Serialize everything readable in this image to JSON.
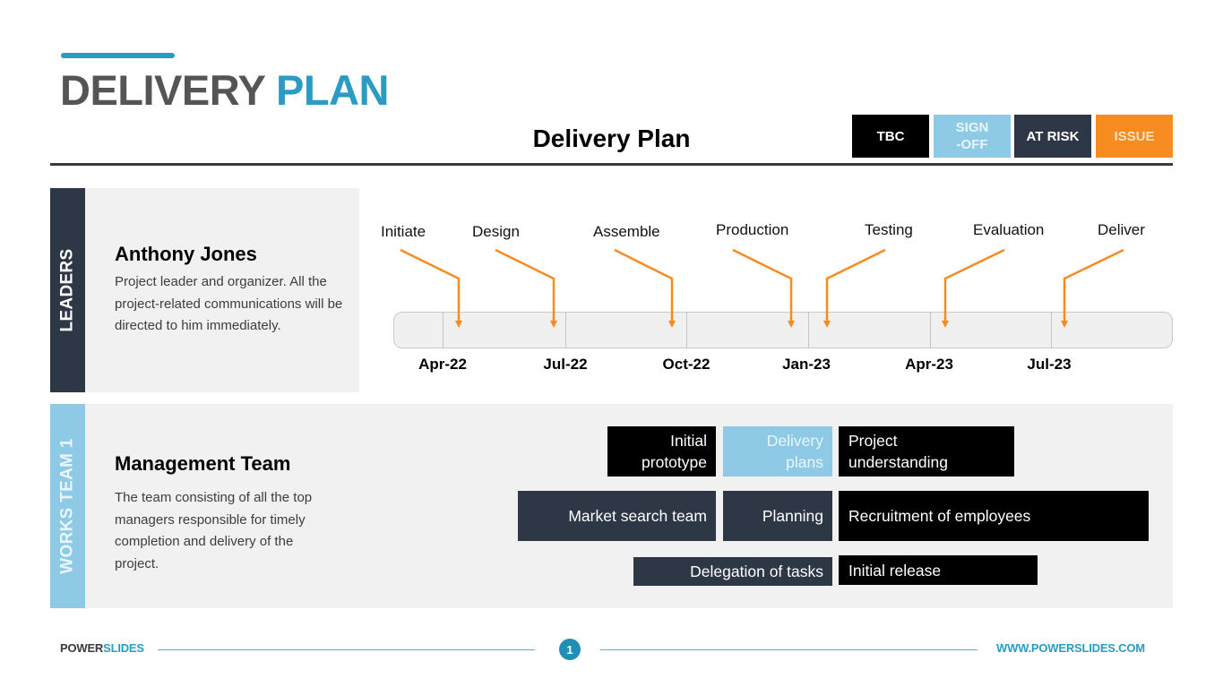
{
  "header": {
    "title_part1": "DELIVERY",
    "title_part2": "PLAN",
    "subtitle": "Delivery Plan"
  },
  "legend": [
    {
      "label": "TBC",
      "color": "#000000"
    },
    {
      "label": "SIGN -OFF",
      "color": "#8ecae6"
    },
    {
      "label": "AT RISK",
      "color": "#2d3746"
    },
    {
      "label": "ISSUE",
      "color": "#f68b1f"
    }
  ],
  "leaders": {
    "tab_label": "LEADERS",
    "name": "Anthony Jones",
    "description": "Project leader and organizer. All the project-related communications will be directed to him immediately."
  },
  "timeline": {
    "dates": [
      "Apr-22",
      "Jul-22",
      "Oct-22",
      "Jan-23",
      "Apr-23",
      "Jul-23"
    ],
    "milestones": [
      {
        "label": "Initiate",
        "direction": "right"
      },
      {
        "label": "Design",
        "direction": "right"
      },
      {
        "label": "Assemble",
        "direction": "right"
      },
      {
        "label": "Production",
        "direction": "right"
      },
      {
        "label": "Testing",
        "direction": "left"
      },
      {
        "label": "Evaluation",
        "direction": "left"
      },
      {
        "label": "Deliver",
        "direction": "left"
      }
    ],
    "arrow_color": "#f68b1f"
  },
  "works_team": {
    "tab_label": "WORKS TEAM 1",
    "name": "Management Team",
    "description": "The team consisting of all the top managers responsible for timely completion and delivery of the project.",
    "tasks": [
      {
        "label": "Initial prototype",
        "status": "TBC"
      },
      {
        "label": "Delivery plans",
        "status": "SIGN -OFF"
      },
      {
        "label": "Project understanding",
        "status": "TBC"
      },
      {
        "label": "Market search team",
        "status": "AT RISK"
      },
      {
        "label": "Planning",
        "status": "AT RISK"
      },
      {
        "label": "Recruitment of employees",
        "status": "TBC"
      },
      {
        "label": "Delegation of tasks",
        "status": "AT RISK"
      },
      {
        "label": "Initial release",
        "status": "TBC"
      }
    ]
  },
  "footer": {
    "brand_part1": "POWER",
    "brand_part2": "SLIDES",
    "page_number": "1",
    "url": "WWW.POWERSLIDES.COM"
  }
}
